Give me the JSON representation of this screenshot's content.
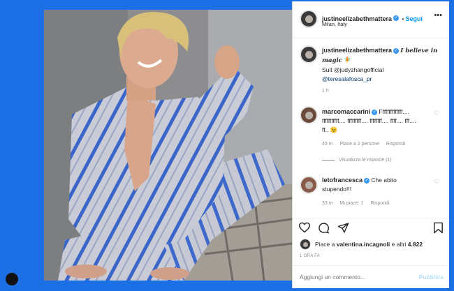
{
  "header": {
    "username": "justineelizabethmattera",
    "verified_icon": "verified-badge-icon",
    "follow_label": "Segui",
    "location": "Milan, Italy",
    "more_icon": "ellipsis-icon"
  },
  "caption": {
    "username": "justineelizabethmattera",
    "text_fancy": "I believe in magic",
    "emoji": "🧚",
    "line2": "Suit @judyzhangofficial",
    "line3": "@teresalafosca_pr",
    "time": "1 h"
  },
  "comments": [
    {
      "username": "marcomaccarini",
      "text_l1": "Ffffffffffffff....",
      "text_l2": "fffffffffff.... fffffffff.... ffffffff.... ffff.... fff....",
      "text_l3": "ff..",
      "emoji": "😉",
      "time": "49 m",
      "likes": "Piace a 2 persone",
      "reply": "Rispondi",
      "view_replies": "Visualizza le risposte (1)"
    },
    {
      "username": "letofrancesca",
      "text_l1": "Che abito",
      "text_l2": "stupendo!!!",
      "time": "33 m",
      "likes": "Mi piace: 1",
      "reply": "Rispondi"
    }
  ],
  "likes": {
    "prefix": "Piace a ",
    "user": "valentina.incagnoli",
    "mid": " e altri ",
    "count": "4.822"
  },
  "post_time": "1 ORA FA",
  "comment_input": {
    "placeholder": "Aggiungi un commento...",
    "publish_label": "Pubblica"
  },
  "colors": {
    "background": "#1d6fe6",
    "verified": "#3897f0",
    "link": "#00376b",
    "publish": "#b2dffc"
  }
}
